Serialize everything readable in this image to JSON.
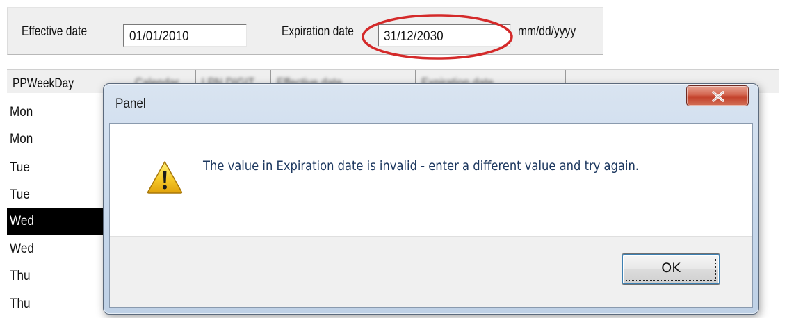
{
  "form": {
    "effective_label": "Effective date",
    "effective_value": "01/01/2010",
    "expiration_label": "Expiration date",
    "expiration_value": "31/12/2030",
    "format_hint": "mm/dd/yyyy",
    "highlight_color": "#d42a2a"
  },
  "grid": {
    "columns": [
      {
        "label": "PPWeekDay"
      },
      {
        "label": "Calendar"
      },
      {
        "label": "LPN DIGIT"
      },
      {
        "label": "Effective date"
      },
      {
        "label": "Expiration date"
      }
    ],
    "rows": [
      "Mon",
      "Mon",
      "Tue",
      "Tue",
      "Wed",
      "Wed",
      "Thu",
      "Thu"
    ],
    "selected_index": 4
  },
  "dialog": {
    "title": "Panel",
    "close_icon": "close-x-icon",
    "message_icon": "warning-icon",
    "message": "The value in Expiration date is invalid - enter a different value and try again.",
    "ok_label": "OK",
    "close_color": "#c7452f"
  }
}
